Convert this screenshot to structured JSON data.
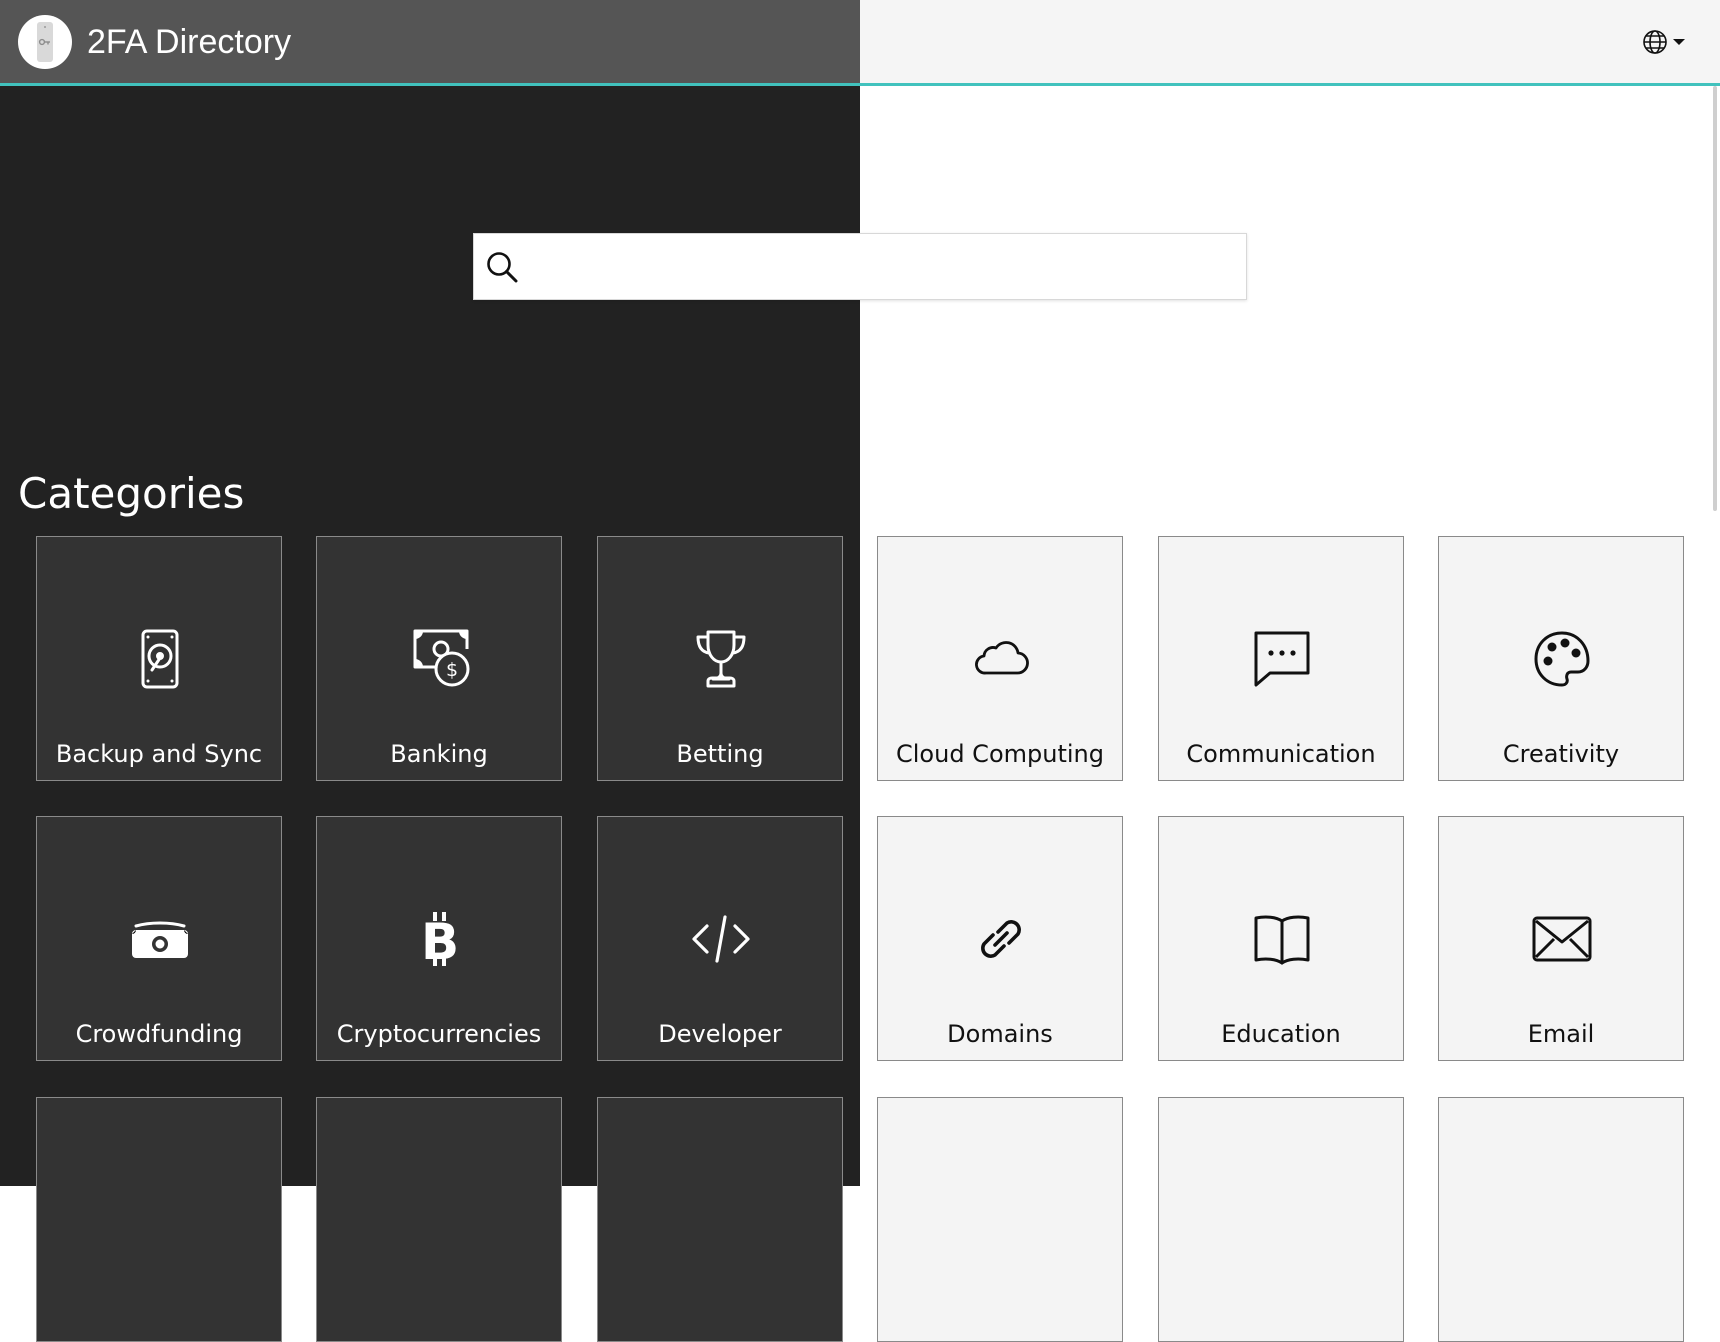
{
  "header": {
    "title": "2FA Directory",
    "logo_icon": "phone-key-icon",
    "language_icon": "globe-icon",
    "accent_color": "#41c2bd"
  },
  "search": {
    "placeholder": "",
    "value": "",
    "icon": "search-icon"
  },
  "categories": {
    "title": "Categories",
    "items": [
      {
        "label": "Backup and Sync",
        "icon": "hard-drive-icon"
      },
      {
        "label": "Banking",
        "icon": "cash-dollar-icon"
      },
      {
        "label": "Betting",
        "icon": "trophy-icon"
      },
      {
        "label": "Cloud Computing",
        "icon": "cloud-icon"
      },
      {
        "label": "Communication",
        "icon": "chat-bubble-icon"
      },
      {
        "label": "Creativity",
        "icon": "palette-icon"
      },
      {
        "label": "Crowdfunding",
        "icon": "money-bill-icon"
      },
      {
        "label": "Cryptocurrencies",
        "icon": "bitcoin-icon"
      },
      {
        "label": "Developer",
        "icon": "code-icon"
      },
      {
        "label": "Domains",
        "icon": "link-icon"
      },
      {
        "label": "Education",
        "icon": "book-icon"
      },
      {
        "label": "Email",
        "icon": "envelope-icon"
      }
    ]
  },
  "theme": {
    "dark_background": "#222222",
    "dark_tile": "#333333",
    "light_background": "#ffffff",
    "light_tile": "#f4f4f4"
  }
}
